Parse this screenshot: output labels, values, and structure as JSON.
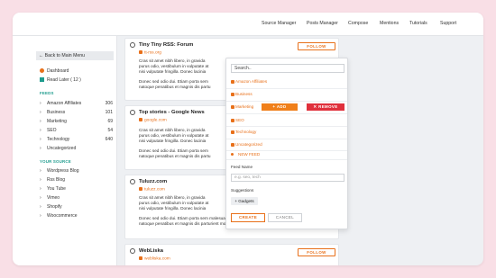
{
  "topnav": [
    "Source Manager",
    "Posts Manager",
    "Compose",
    "Mentions",
    "Tutorials",
    "Support"
  ],
  "sidebar": {
    "back": "Back to Main Menu",
    "dashboard": "Dashboard",
    "read_later": "Read Later ( 12 )",
    "feeds_heading": "FEEDS",
    "feeds": [
      {
        "label": "Amazon Affiliates",
        "count": "306"
      },
      {
        "label": "Business",
        "count": "101"
      },
      {
        "label": "Marketing",
        "count": "69"
      },
      {
        "label": "SEO",
        "count": "54"
      },
      {
        "label": "Technology",
        "count": "640"
      },
      {
        "label": "Uncategorized",
        "count": ""
      }
    ],
    "source_heading": "YOUR SOURCE",
    "sources": [
      "Wordpress Blog",
      "Rss Blog",
      "You Tube",
      "Vimeo",
      "Shopify",
      "Woocommerce"
    ]
  },
  "cards": [
    {
      "title": "Tiny Tiny RSS: Forum",
      "source": "tt-rss.org",
      "follow": "FOLLOW",
      "lines": [
        "Cras sit amet nibh libero, in gravida",
        "purus odio, vestibulum in vulputate at",
        "nisi vulputate fringilla. Donec lacinia",
        "Donec sed odio dui. Etiam porta sem",
        "natoque penatibus et magnis dis partu"
      ]
    },
    {
      "title": "Top stories - Google News",
      "source": "google.com",
      "follow": "",
      "lines": [
        "Cras sit amet nibh libero, in gravida",
        "purus odio, vestibulum in vulputate at",
        "nisi vulputate fringilla. Donec lacinia",
        "Donec sed odio dui. Etiam porta sem",
        "natoque penatibus et magnis dis partu"
      ]
    },
    {
      "title": "Tuluzz.com",
      "source": "tuluzz.com",
      "follow": "",
      "lines": [
        "Cras sit amet nibh libero, in gravida",
        "purus odio, vestibulum in vulputate at",
        "nisi vulputate fringilla. Donec lacinia",
        "Donec sed odio dui. Etiam porta sem malesuada magna mollis euismod. Cum sociis",
        "natoque penatibus et magnis dis parturient montes, nascetur ridiculus mus."
      ]
    },
    {
      "title": "WebLiska",
      "source": "webliska.com",
      "follow": "FOLLOW",
      "lines": []
    }
  ],
  "dropdown": {
    "search_placeholder": "Search..",
    "items": [
      "Amazon Affiliates",
      "Business",
      "Marketing",
      "SEO",
      "Technology",
      "Uncategorized"
    ],
    "add": "+ ADD",
    "remove": "✕ REMOVE",
    "new_feed": "NEW FEED",
    "feed_name_label": "Feed Name",
    "feed_name_placeholder": "e.g. seo, tech",
    "suggestions_label": "Suggestions",
    "suggestion": "Gadgets",
    "create": "CREATE",
    "cancel": "CANCEL"
  },
  "colors": {
    "accent": "#e8701a",
    "remove": "#e0303c",
    "heading": "#1f9c8e",
    "page_bg": "#f9dfe6"
  }
}
